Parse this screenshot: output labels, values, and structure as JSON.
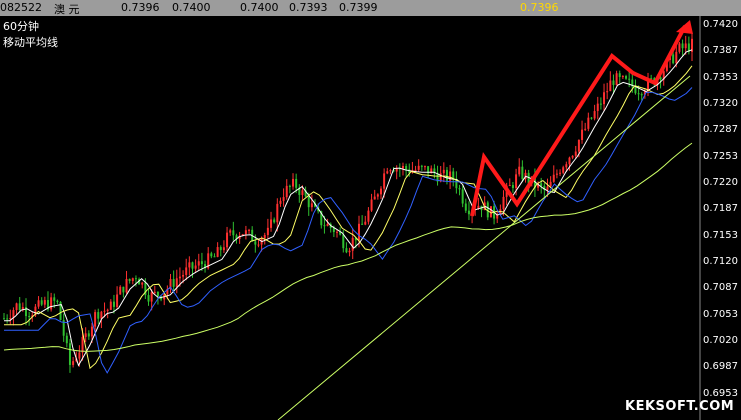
{
  "header": {
    "code": "082522",
    "name": "澳    元",
    "price1": "0.7396",
    "price2": "0.7400",
    "price3": "0.7400",
    "price4": "0.7393",
    "price5": "0.7399",
    "highlight": "0.7396"
  },
  "chart": {
    "period": "60分钟",
    "indicator": "移动平均线"
  },
  "watermark": "KEKSOFT.COM",
  "colors": {
    "background": "#000000",
    "header_bg": "#9c9c9c",
    "up_candle": "#ff3030",
    "down_candle": "#30c030",
    "ma_short": "#ffffff",
    "ma_mid": "#ffff66",
    "ma_long": "#3060ff",
    "ma_slow": "#ccff66",
    "annotation": "#ff1a1a"
  },
  "chart_data": {
    "type": "candlestick",
    "y_ticks": [
      "0.7420",
      "0.7387",
      "0.7353",
      "0.7320",
      "0.7287",
      "0.7253",
      "0.7220",
      "0.7187",
      "0.7153",
      "0.7120",
      "0.7087",
      "0.7053",
      "0.7020",
      "0.6987",
      "0.6953"
    ],
    "ylim": [
      0.6953,
      0.742
    ],
    "series": [
      {
        "name": "",
        "values": [
          0.705,
          0.7067,
          0.7058,
          0.7068,
          0.7071,
          0.699,
          0.702,
          0.7058,
          0.7062,
          0.709,
          0.7105,
          0.7078,
          0.7082,
          0.71,
          0.7112,
          0.712,
          0.7128,
          0.7155,
          0.716,
          0.715,
          0.7158,
          0.7208,
          0.722,
          0.7198,
          0.7172,
          0.7162,
          0.714,
          0.7165,
          0.72,
          0.7245,
          0.724,
          0.7238,
          0.7238,
          0.723,
          0.7228,
          0.719,
          0.7195,
          0.718,
          0.721,
          0.7235,
          0.722,
          0.721,
          0.724,
          0.7262,
          0.7292,
          0.732,
          0.7353,
          0.7348,
          0.734,
          0.735,
          0.7368,
          0.739,
          0.7396
        ]
      }
    ]
  }
}
